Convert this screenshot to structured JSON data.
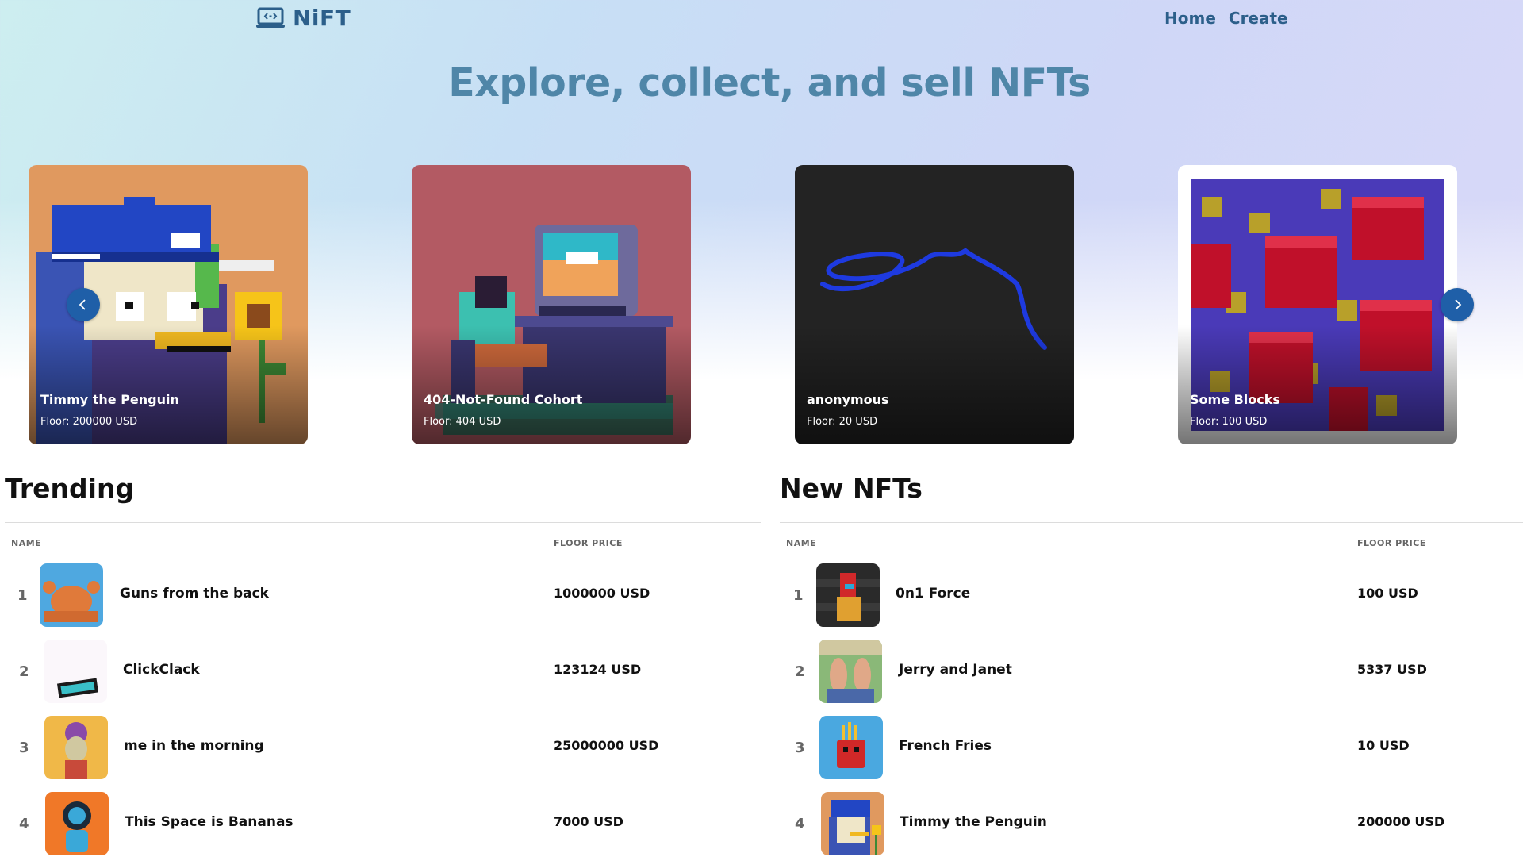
{
  "header": {
    "logo_text": "NiFT",
    "nav": [
      {
        "label": "Home"
      },
      {
        "label": "Create"
      }
    ]
  },
  "hero": {
    "title": "Explore, collect, and sell NFTs"
  },
  "carousel": {
    "items": [
      {
        "name": "Timmy the Penguin",
        "floor": "Floor: 200000 USD",
        "bg": "#e0995f"
      },
      {
        "name": "404-Not-Found Cohort",
        "floor": "Floor: 404 USD",
        "bg": "#b35a63"
      },
      {
        "name": "anonymous",
        "floor": "Floor: 20 USD",
        "bg": "#232323"
      },
      {
        "name": "Some Blocks",
        "floor": "Floor: 100 USD",
        "bg": "#ffffff"
      }
    ],
    "prev_icon": "chevron-left-icon",
    "next_icon": "chevron-right-icon"
  },
  "trending": {
    "title": "Trending",
    "col_name": "NAME",
    "col_price": "FLOOR PRICE",
    "rows": [
      {
        "rank": "1",
        "name": "Guns from the back",
        "price": "1000000 USD"
      },
      {
        "rank": "2",
        "name": "ClickClack",
        "price": "123124 USD"
      },
      {
        "rank": "3",
        "name": "me in the morning",
        "price": "25000000 USD"
      },
      {
        "rank": "4",
        "name": "This Space is Bananas",
        "price": "7000 USD"
      }
    ]
  },
  "new_nfts": {
    "title": "New NFTs",
    "col_name": "NAME",
    "col_price": "FLOOR PRICE",
    "rows": [
      {
        "rank": "1",
        "name": "0n1 Force",
        "price": "100 USD"
      },
      {
        "rank": "2",
        "name": "Jerry and Janet",
        "price": "5337 USD"
      },
      {
        "rank": "3",
        "name": "French Fries",
        "price": "10 USD"
      },
      {
        "rank": "4",
        "name": "Timmy the Penguin",
        "price": "200000 USD"
      }
    ]
  },
  "colors": {
    "brand": "#2c5f8a",
    "hero_text": "#4f86a8",
    "arrow": "#1f5fa8"
  }
}
